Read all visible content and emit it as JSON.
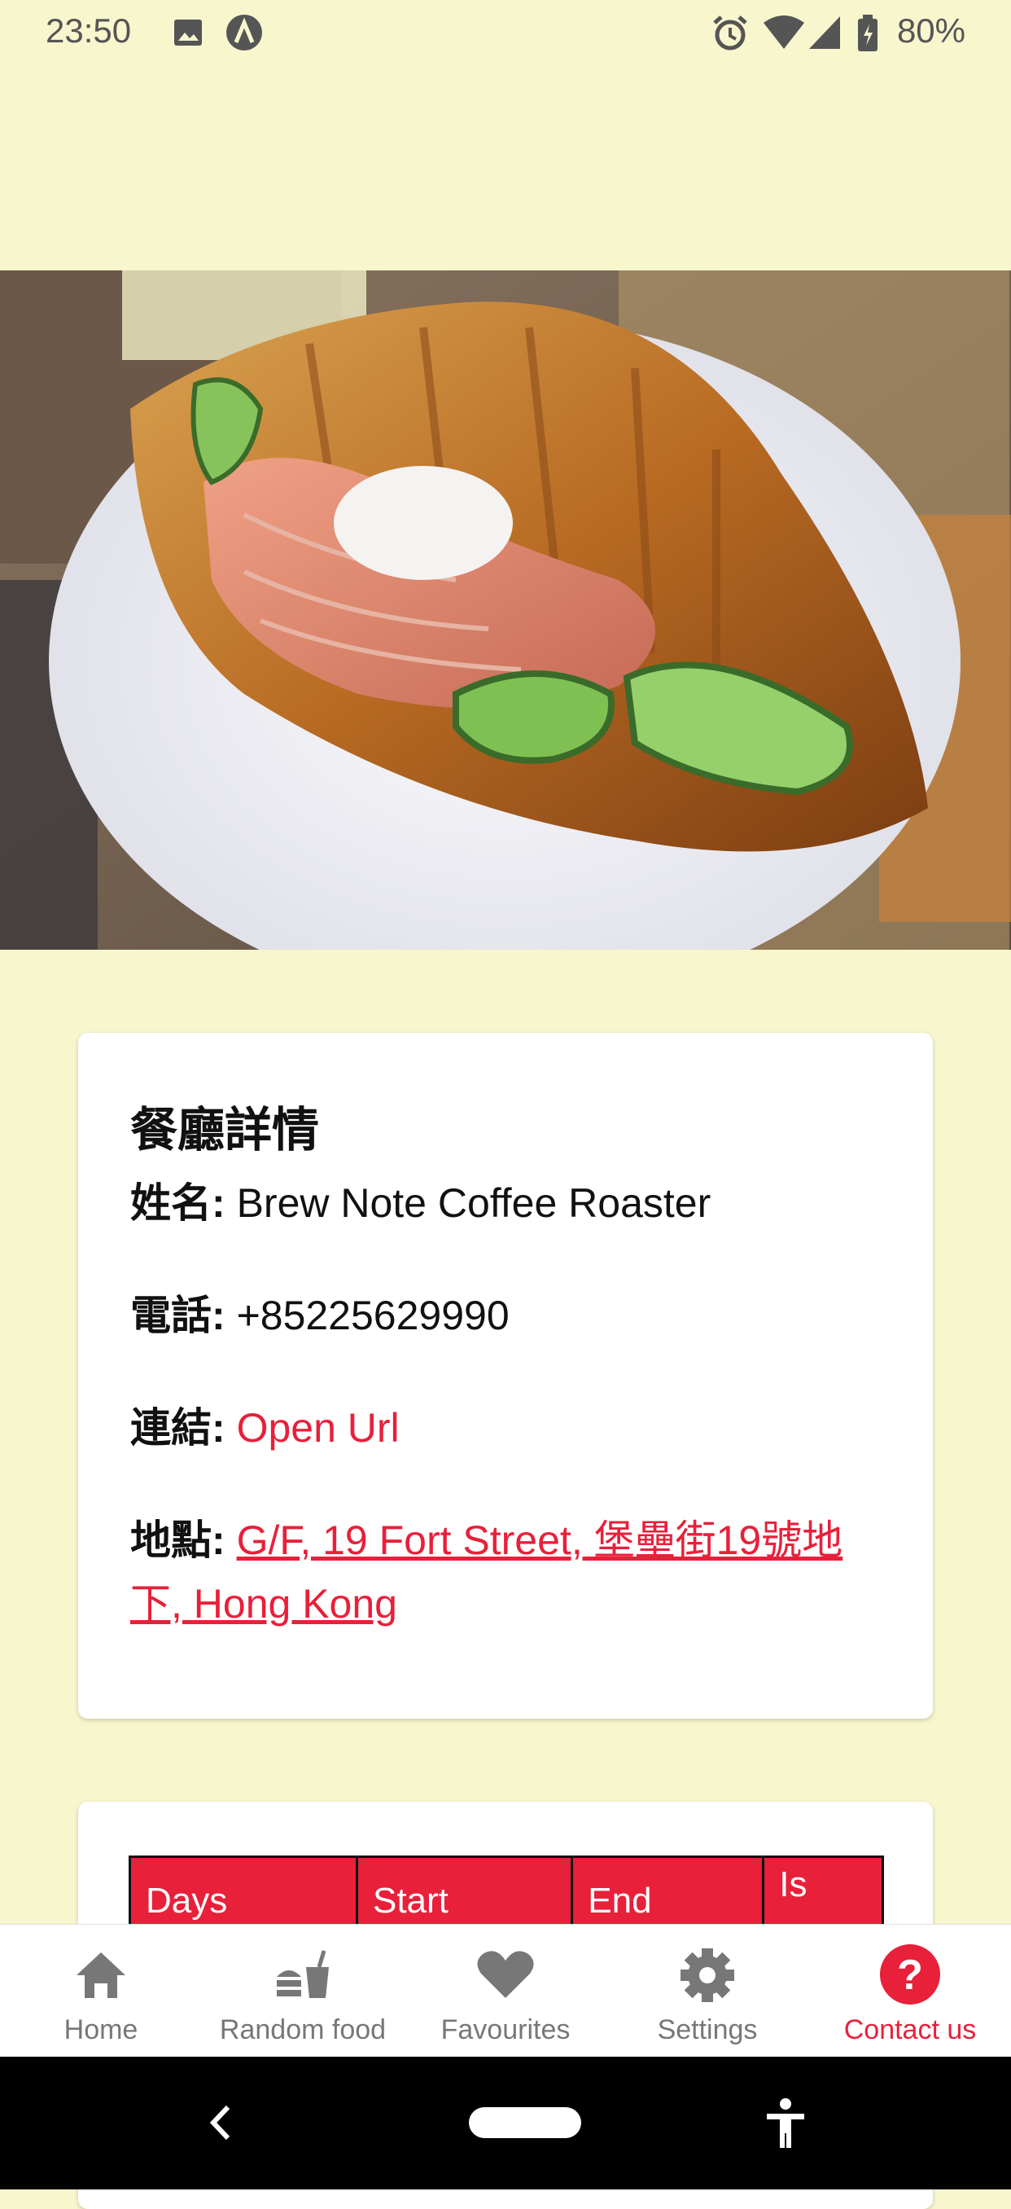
{
  "status_bar": {
    "time": "23:50",
    "battery": "80%",
    "icons": [
      "image-icon",
      "app-icon",
      "alarm-icon",
      "wifi-icon",
      "signal-icon",
      "battery-icon"
    ]
  },
  "hero": {
    "carousel_page_count": 3,
    "carousel_active_index": 0
  },
  "details": {
    "title": "餐廳詳情",
    "name_label": "姓名:",
    "name_value": "Brew Note Coffee Roaster",
    "phone_label": "電話:",
    "phone_value": "+85225629990",
    "link_label": "連結:",
    "link_value": "Open Url",
    "address_label": "地點:",
    "address_line1": "G/F, 19 Fort Street, 堡壘街19號地",
    "address_line2": "下, Hong Kong"
  },
  "hours_table": {
    "headers": [
      "Days",
      "Start",
      "End",
      "Is"
    ]
  },
  "bottom_nav": {
    "items": [
      {
        "label": "Home",
        "icon": "home-icon"
      },
      {
        "label": "Random food",
        "icon": "fastfood-icon"
      },
      {
        "label": "Favourites",
        "icon": "heart-icon"
      },
      {
        "label": "Settings",
        "icon": "gear-icon"
      },
      {
        "label": "Contact us",
        "icon": "help-icon"
      }
    ],
    "active_index": 4
  },
  "colors": {
    "background": "#f8f6cd",
    "accent": "#e8203a",
    "card": "#ffffff",
    "nav_inactive": "#777777"
  }
}
